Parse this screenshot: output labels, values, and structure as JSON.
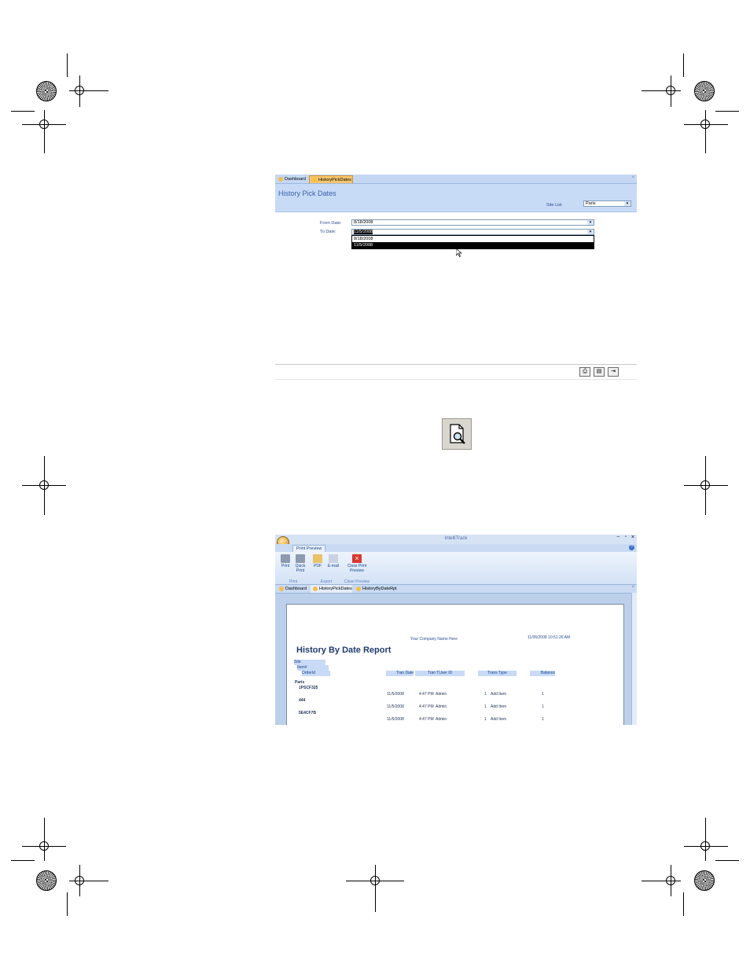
{
  "screen1": {
    "tabs": [
      {
        "label": "Dashboard",
        "active": false
      },
      {
        "label": "HistoryPickDates",
        "active": true
      }
    ],
    "form_title": "History Pick Dates",
    "site_list_label": "Site List",
    "site_list_value": "Paris",
    "from_date_label": "From Date:",
    "from_date_value": "8/18/2008",
    "to_date_label": "To Date:",
    "to_date_value": "11/5/2008",
    "dropdown_options": [
      "8/18/2008",
      "11/5/2008"
    ],
    "selected_option": "11/5/2008"
  },
  "screen2": {
    "app_title": "IntelliTrack",
    "ribbon_tab": "Print Preview",
    "buttons": {
      "print": "Print",
      "quick_print_1": "Quick",
      "quick_print_2": "Print",
      "pdf": "PDF",
      "email": "E-mail",
      "close_1": "Close Print",
      "close_2": "Preview"
    },
    "groups": {
      "print": "Print",
      "export": "Export",
      "close": "Close Preview"
    },
    "doc_tabs": [
      "Dashboard",
      "HistoryPickDates",
      "HistoryByDateRpt"
    ],
    "report": {
      "company": "Your Company Name Here",
      "timestamp": "11/06/2008 10:51:26 AM",
      "title": "History By Date Report",
      "headers": {
        "site": "Site",
        "item": "Item#",
        "orderid": "OrderId",
        "tran_date": "Tran Date",
        "tran_time_user": "Tran TUser ID",
        "trans_type": "Trans Type",
        "balance": "Balance"
      },
      "site_name": "Paris",
      "items": [
        "1PSCF325",
        "444",
        "5E4CF7B"
      ],
      "rows": [
        {
          "date": "11/5/2008",
          "time": "4:47 PM",
          "user": "Admin",
          "qty": "1",
          "type": "Add Item",
          "balance": "1"
        },
        {
          "date": "11/5/2008",
          "time": "4:47 PM",
          "user": "Admin",
          "qty": "1",
          "type": "Add Item",
          "balance": "1"
        },
        {
          "date": "11/5/2008",
          "time": "4:47 PM",
          "user": "Admin",
          "qty": "1",
          "type": "Add Item",
          "balance": "1"
        }
      ]
    }
  },
  "colors": {
    "form_header": "#c7dbf7",
    "active_tab": "#f6c56a",
    "report_title": "#1f3b6e"
  }
}
